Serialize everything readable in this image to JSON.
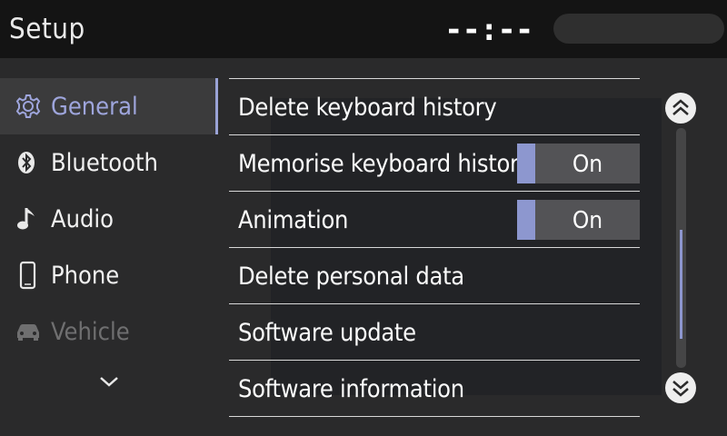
{
  "header": {
    "title": "Setup",
    "clock": "--:--"
  },
  "sidebar": {
    "items": [
      {
        "label": "General",
        "icon": "gear-icon",
        "active": true
      },
      {
        "label": "Bluetooth",
        "icon": "bluetooth-icon"
      },
      {
        "label": "Audio",
        "icon": "music-note-icon"
      },
      {
        "label": "Phone",
        "icon": "phone-icon"
      },
      {
        "label": "Vehicle",
        "icon": "car-icon",
        "disabled": true
      }
    ],
    "more_icon": "chevron-down-icon"
  },
  "settings": {
    "rows": [
      {
        "label": "Delete keyboard history"
      },
      {
        "label": "Memorise keyboard history",
        "toggle": "On"
      },
      {
        "label": "Animation",
        "toggle": "On"
      },
      {
        "label": "Delete personal data"
      },
      {
        "label": "Software update"
      },
      {
        "label": "Software information"
      }
    ]
  },
  "scroll": {
    "up_icon": "double-chevron-up-icon",
    "down_icon": "double-chevron-down-icon"
  },
  "colors": {
    "accent": "#8d97cf",
    "active_text": "#9ea5dc",
    "background": "#2a2a2b",
    "header": "#141414"
  }
}
